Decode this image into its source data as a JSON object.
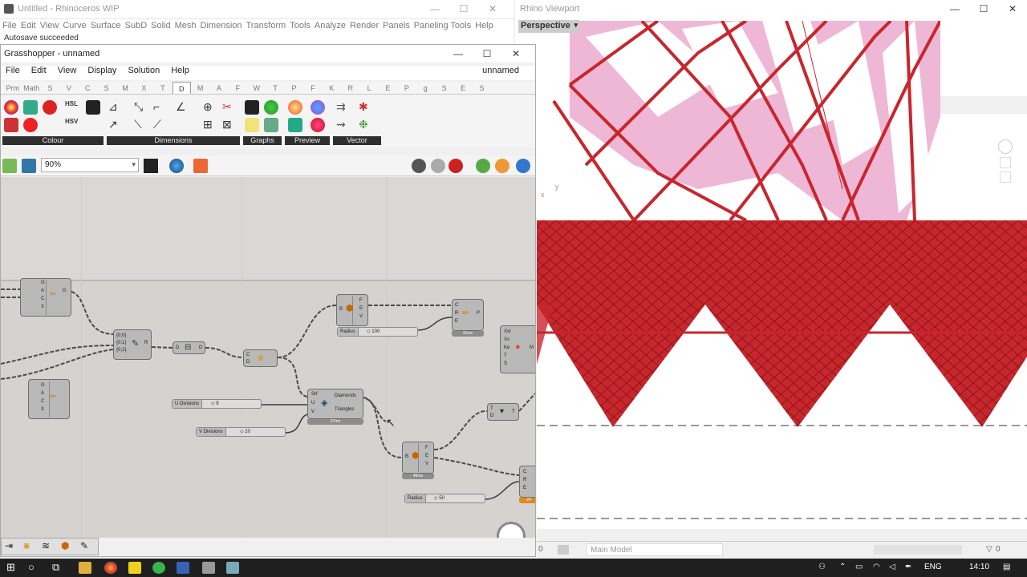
{
  "rhino": {
    "title": "Untitled - Rhinoceros WIP",
    "menu": [
      "File",
      "Edit",
      "View",
      "Curve",
      "Surface",
      "SubD",
      "Solid",
      "Mesh",
      "Dimension",
      "Transform",
      "Tools",
      "Analyze",
      "Render",
      "Panels",
      "Paneling Tools",
      "Help"
    ],
    "command_output": "Autosave succeeded",
    "win_controls": [
      "—",
      "☐",
      "✕"
    ]
  },
  "grasshopper": {
    "title": "Grasshopper - unnamed",
    "menu": [
      "File",
      "Edit",
      "View",
      "Display",
      "Solution",
      "Help"
    ],
    "document_name": "unnamed",
    "tabs": [
      "Prm",
      "Math",
      "S",
      "V",
      "C",
      "S",
      "M",
      "X",
      "T",
      "D",
      "M",
      "A",
      "F",
      "W",
      "T",
      "P",
      "F",
      "K",
      "R",
      "L",
      "E",
      "P",
      "g",
      "S",
      "E",
      "S"
    ],
    "active_tab_index": 9,
    "ribbon_groups": [
      "Colour",
      "Dimensions",
      "Graphs",
      "Preview",
      "Vector"
    ],
    "zoom": "90%"
  },
  "canvas": {
    "components": {
      "c1_inputs": [
        "G",
        "A",
        "C",
        "X"
      ],
      "c1_out": "G",
      "c2_inputs": [
        "G",
        "A",
        "C",
        "X"
      ],
      "c3_inputs": [
        "{0;0}",
        "{0;1}",
        "{0;2}"
      ],
      "c3_out": "R",
      "c4_in": "D",
      "c4_out": "D",
      "c5_in": [
        "C",
        "D"
      ],
      "c6_in": [
        "B",
        "E",
        "V"
      ],
      "c6_out": [
        "F",
        "E",
        "V"
      ],
      "c7_in": [
        "C",
        "R",
        "E"
      ],
      "c7_out": "P",
      "c8_in": [
        "XxI",
        "Xs",
        "Ke",
        "T",
        "S"
      ],
      "c8_out": "M",
      "diamond_in": [
        "Srf",
        "U",
        "V"
      ],
      "diamond_out": [
        "Diamonds",
        "Triangles"
      ],
      "c10_in": [
        "T",
        "D"
      ],
      "c10_out": "T",
      "c11_in": [
        "B"
      ],
      "c11_out": [
        "F",
        "E",
        "V"
      ],
      "c12_in": [
        "C",
        "R",
        "E"
      ]
    },
    "sliders": [
      {
        "name": "Radius",
        "value": "◇ 100"
      },
      {
        "name": "U Divisions",
        "value": "◇ 9"
      },
      {
        "name": "V Divisions",
        "value": "◇ 20"
      },
      {
        "name": "Radius",
        "value": "◇ 50"
      }
    ],
    "timers": [
      "41ms",
      "27ms",
      "46ms",
      "24"
    ]
  },
  "viewport": {
    "title": "Rhino Viewport",
    "label": "Perspective",
    "axis_labels": [
      "y",
      "x"
    ]
  },
  "statusbar": {
    "layer": "Main Model",
    "left_value": "0",
    "right_value": "0"
  },
  "taskbar": {
    "lang": "ENG",
    "time": "14:10"
  },
  "colors": {
    "accent_red": "#c8262d",
    "surface_pink": "#e56aa9",
    "canvas_bg": "#d4d3d0"
  }
}
